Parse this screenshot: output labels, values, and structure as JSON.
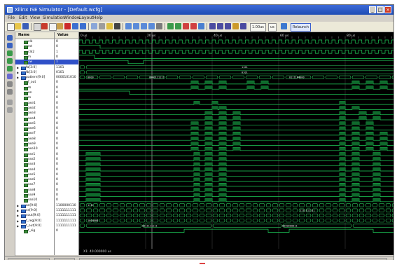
{
  "window": {
    "title": "Xilinx ISE Simulator - [Default.wcfg]",
    "buttons": {
      "minimize": "_",
      "maximize": "□",
      "close": "×"
    }
  },
  "menu": [
    "File",
    "Edit",
    "View",
    "Simulation",
    "Window",
    "Layout",
    "Help"
  ],
  "toolbar": {
    "time_value": "1.00us",
    "time_unit": "us",
    "relaunch_label": "Relaunch"
  },
  "columns": {
    "name": "Name",
    "value": "Value"
  },
  "signals": [
    {
      "name": "clk",
      "value": "0",
      "bus": false,
      "selected": false
    },
    {
      "name": "rst",
      "value": "0",
      "bus": false,
      "selected": false
    },
    {
      "name": "clk2",
      "value": "1",
      "bus": false,
      "selected": false
    },
    {
      "name": "in",
      "value": "0",
      "bus": false,
      "selected": false
    },
    {
      "name": "sw",
      "value": "1",
      "bus": false,
      "selected": true
    },
    {
      "name": "fa[3:0]",
      "value": "1101",
      "bus": true,
      "selected": false
    },
    {
      "name": "fb[3:0]",
      "value": "0101",
      "bus": true,
      "selected": false
    },
    {
      "name": "pattern[9:0]",
      "value": "0000101010",
      "bus": true,
      "selected": false
    },
    {
      "name": "f_out",
      "value": "0",
      "bus": false,
      "selected": false
    },
    {
      "name": "m",
      "value": "0",
      "bus": false,
      "selected": false
    },
    {
      "name": "en",
      "value": "0",
      "bus": false,
      "selected": false
    },
    {
      "name": "rx",
      "value": "0",
      "bus": false,
      "selected": false
    },
    {
      "name": "ase1",
      "value": "0",
      "bus": false,
      "selected": false
    },
    {
      "name": "ase2",
      "value": "0",
      "bus": false,
      "selected": false
    },
    {
      "name": "ase3",
      "value": "0",
      "bus": false,
      "selected": false
    },
    {
      "name": "ase4",
      "value": "0",
      "bus": false,
      "selected": false
    },
    {
      "name": "ase5",
      "value": "0",
      "bus": false,
      "selected": false
    },
    {
      "name": "ase6",
      "value": "0",
      "bus": false,
      "selected": false
    },
    {
      "name": "ase7",
      "value": "0",
      "bus": false,
      "selected": false
    },
    {
      "name": "ase8",
      "value": "0",
      "bus": false,
      "selected": false
    },
    {
      "name": "ase9",
      "value": "0",
      "bus": false,
      "selected": false
    },
    {
      "name": "ase10",
      "value": "0",
      "bus": false,
      "selected": false
    },
    {
      "name": "sse1",
      "value": "0",
      "bus": false,
      "selected": false
    },
    {
      "name": "sse2",
      "value": "0",
      "bus": false,
      "selected": false
    },
    {
      "name": "sse3",
      "value": "0",
      "bus": false,
      "selected": false
    },
    {
      "name": "sse4",
      "value": "0",
      "bus": false,
      "selected": false
    },
    {
      "name": "sse5",
      "value": "0",
      "bus": false,
      "selected": false
    },
    {
      "name": "sse6",
      "value": "0",
      "bus": false,
      "selected": false
    },
    {
      "name": "sse7",
      "value": "0",
      "bus": false,
      "selected": false
    },
    {
      "name": "sse8",
      "value": "0",
      "bus": false,
      "selected": false
    },
    {
      "name": "sse9",
      "value": "0",
      "bus": false,
      "selected": false
    },
    {
      "name": "sse10",
      "value": "0",
      "bus": false,
      "selected": false
    },
    {
      "name": "ae[9:0]",
      "value": "1100000110",
      "bus": true,
      "selected": false
    },
    {
      "name": "se[9:0]",
      "value": "1111111111",
      "bus": true,
      "selected": false
    },
    {
      "name": "sout[9:0]",
      "value": "1111111111",
      "bus": true,
      "selected": false
    },
    {
      "name": "f_reg[9:0]",
      "value": "1111111111",
      "bus": true,
      "selected": false
    },
    {
      "name": "f_out[9:0]",
      "value": "1111111111",
      "bus": true,
      "selected": false
    },
    {
      "name": "f_sig",
      "value": "0",
      "bus": false,
      "selected": false
    }
  ],
  "timeline": {
    "labels": [
      "0 us",
      "20 us",
      "40 us",
      "60 us",
      "80 us"
    ]
  },
  "bus_texts": [
    {
      "row": 5,
      "text": "1101"
    },
    {
      "row": 6,
      "text": "0101"
    },
    {
      "row": 7,
      "text": "0000"
    },
    {
      "row": 7,
      "text": "0000111111"
    },
    {
      "row": 7,
      "text": "0111100000"
    },
    {
      "row": 32,
      "text": "1111"
    },
    {
      "row": 33,
      "text": "1111111111"
    },
    {
      "row": 35,
      "text": "1000000"
    },
    {
      "row": 36,
      "text": "0011111111"
    },
    {
      "row": 36,
      "text": "0000000011"
    }
  ],
  "cursor_readout": "X1: 40.000000 us",
  "colors": {
    "wave_bg": "#000000",
    "wave_green": "#1fd15a",
    "bus_green": "#2bc35b",
    "grid": "#1c1c1c",
    "cursor": "#c8c8c8"
  }
}
